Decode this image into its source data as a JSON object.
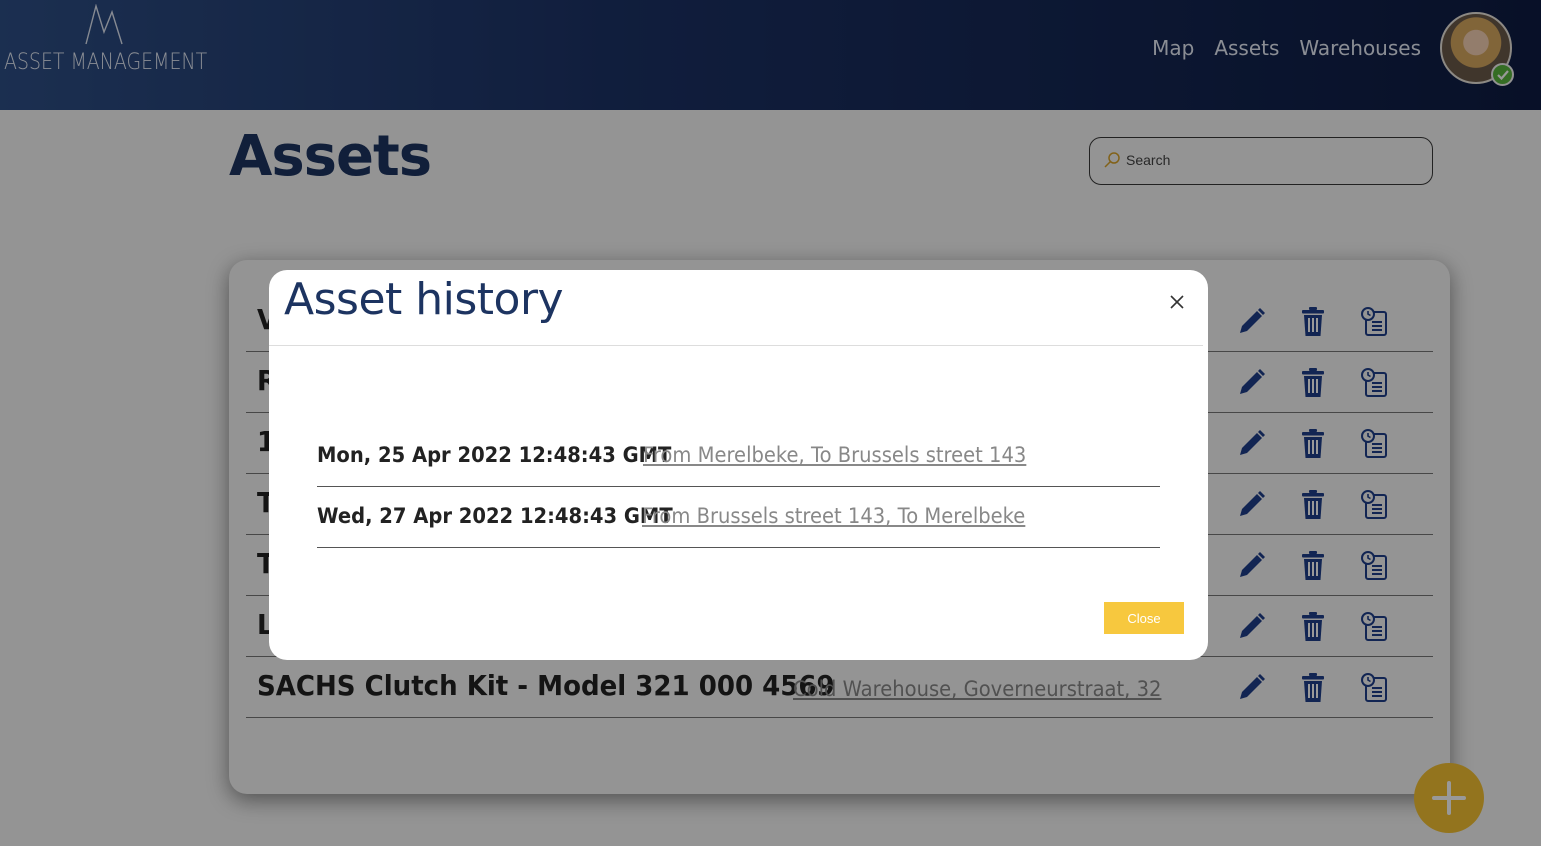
{
  "header": {
    "logo_text": "ASSET MANAGEMENT",
    "nav": [
      {
        "label": "Map"
      },
      {
        "label": "Assets"
      },
      {
        "label": "Warehouses"
      }
    ],
    "status_color": "#59b63d"
  },
  "page": {
    "title": "Assets",
    "search_placeholder": "Search"
  },
  "assets": [
    {
      "name": "V",
      "location": ""
    },
    {
      "name": "R",
      "location": ""
    },
    {
      "name": "1",
      "location": ""
    },
    {
      "name": "T",
      "location": ""
    },
    {
      "name": "T",
      "location": ""
    },
    {
      "name": "L",
      "location": ""
    },
    {
      "name": "SACHS Clutch Kit - Model 321 000 4569",
      "location": "Cold Warehouse, Governeurstraat, 32"
    }
  ],
  "row_actions": [
    "pencil-icon",
    "trash-icon",
    "history-icon"
  ],
  "modal": {
    "title": "Asset history",
    "history": [
      {
        "date": "Mon, 25 Apr 2022 12:48:43 GMT",
        "description": "From Merelbeke, To Brussels street 143"
      },
      {
        "date": "Wed, 27 Apr 2022 12:48:43 GMT",
        "description": "From Brussels street 143, To Merelbeke"
      }
    ],
    "close_label": "Close"
  },
  "colors": {
    "brand_navy": "#1d3461",
    "accent_yellow": "#f5c232",
    "icon_blue": "#1e3f8a"
  }
}
